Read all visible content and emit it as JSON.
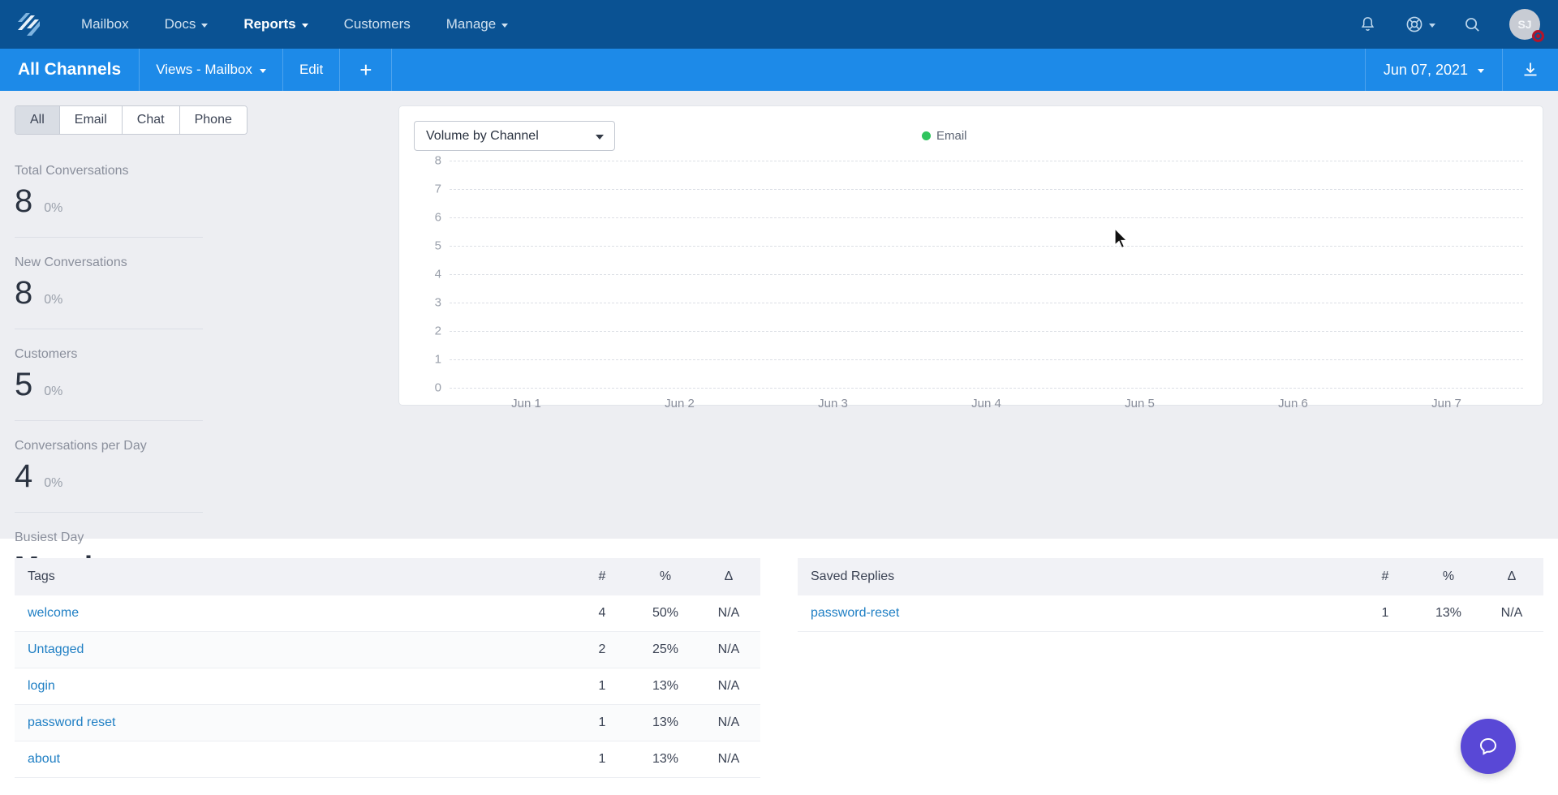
{
  "topnav": {
    "logo_icon": "helpscout-logo-icon",
    "links": [
      {
        "label": "Mailbox",
        "caret": false,
        "active": false
      },
      {
        "label": "Docs",
        "caret": true,
        "active": false
      },
      {
        "label": "Reports",
        "caret": true,
        "active": true
      },
      {
        "label": "Customers",
        "caret": false,
        "active": false
      },
      {
        "label": "Manage",
        "caret": true,
        "active": false
      }
    ],
    "icons": {
      "notifications": "bell-icon",
      "help": "life-ring-icon",
      "search": "search-icon"
    },
    "avatar_initials": "SJ"
  },
  "subnav": {
    "title": "All Channels",
    "view_label": "Views - Mailbox",
    "edit_label": "Edit",
    "add_label": "+",
    "date_label": "Jun 07, 2021",
    "download_icon": "download-icon"
  },
  "filters": {
    "options": [
      "All",
      "Email",
      "Chat",
      "Phone"
    ],
    "selected": "All"
  },
  "stats": [
    {
      "label": "Total Conversations",
      "value": "8",
      "delta": "0%"
    },
    {
      "label": "New Conversations",
      "value": "8",
      "delta": "0%"
    },
    {
      "label": "Customers",
      "value": "5",
      "delta": "0%"
    },
    {
      "label": "Conversations per Day",
      "value": "4",
      "delta": "0%"
    }
  ],
  "busiest": {
    "label": "Busiest Day",
    "value": "Monday"
  },
  "chart_panel": {
    "select_value": "Volume by Channel",
    "select_options": [
      "Volume by Channel"
    ],
    "legend": [
      {
        "name": "Email",
        "color": "#30c45e"
      }
    ]
  },
  "chart_data": {
    "type": "line",
    "title": "Volume by Channel",
    "xlabel": "",
    "ylabel": "",
    "x": [
      "Jun 1",
      "Jun 2",
      "Jun 3",
      "Jun 4",
      "Jun 5",
      "Jun 6",
      "Jun 7"
    ],
    "yticks": [
      8,
      7,
      6,
      5,
      4,
      3,
      2,
      1,
      0
    ],
    "ylim": [
      0,
      8
    ],
    "grid": true,
    "legend_position": "top-right",
    "series": [
      {
        "name": "Email",
        "color": "#30c45e",
        "values": [
          null,
          null,
          null,
          null,
          null,
          null,
          null
        ]
      }
    ]
  },
  "tags_table": {
    "headers": [
      "Tags",
      "#",
      "%",
      "Δ"
    ],
    "rows": [
      {
        "name": "welcome",
        "count": "4",
        "pct": "50%",
        "delta": "N/A"
      },
      {
        "name": "Untagged",
        "count": "2",
        "pct": "25%",
        "delta": "N/A"
      },
      {
        "name": "login",
        "count": "1",
        "pct": "13%",
        "delta": "N/A"
      },
      {
        "name": "password reset",
        "count": "1",
        "pct": "13%",
        "delta": "N/A"
      },
      {
        "name": "about",
        "count": "1",
        "pct": "13%",
        "delta": "N/A"
      }
    ]
  },
  "saved_replies_table": {
    "headers": [
      "Saved Replies",
      "#",
      "%",
      "Δ"
    ],
    "rows": [
      {
        "name": "password-reset",
        "count": "1",
        "pct": "13%",
        "delta": "N/A"
      }
    ]
  },
  "help_fab": {
    "icon": "chat-bubble-icon",
    "color": "#5948d6"
  }
}
